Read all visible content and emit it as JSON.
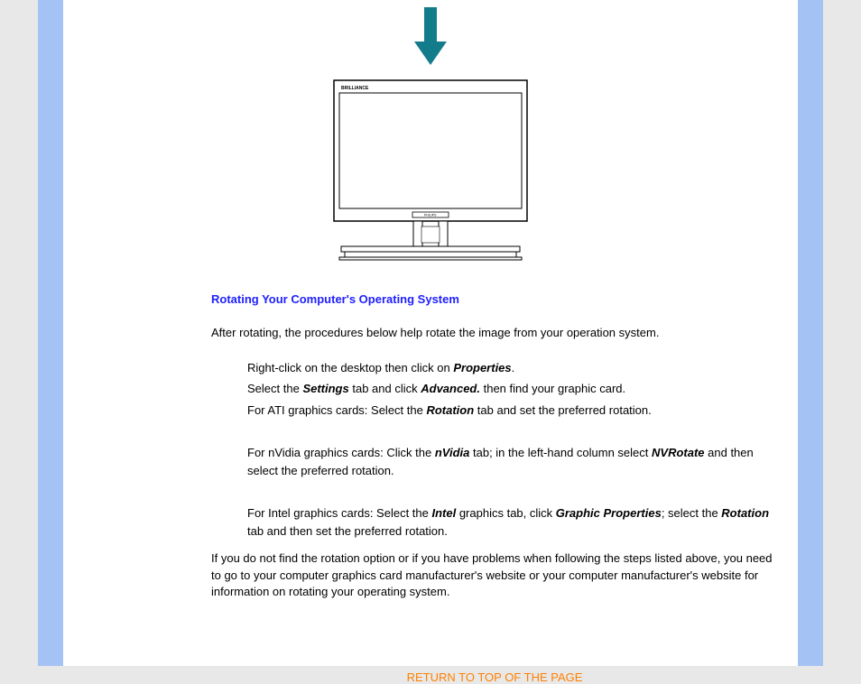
{
  "section_title": "Rotating Your Computer's Operating System",
  "intro": "After rotating, the procedures below help rotate the image from your operation system.",
  "steps": {
    "group1": {
      "line1_pre": "Right-click on the desktop then click on ",
      "line1_b1": "Properties",
      "line1_post": ".",
      "line2_pre": "Select the ",
      "line2_b1": "Settings",
      "line2_mid": " tab and click ",
      "line2_b2": "Advanced.",
      "line2_post": " then find your graphic card.",
      "line3_pre": "For ATI graphics cards: Select the ",
      "line3_b1": "Rotation",
      "line3_post": " tab and set the preferred rotation."
    },
    "group2": {
      "line1_pre": "For nVidia graphics cards: Click the ",
      "line1_b1": "nVidia",
      "line1_mid": " tab; in the left-hand column select ",
      "line1_b2": "NVRotate",
      "line1_post": " and then select the preferred rotation."
    },
    "group3": {
      "line1_pre": "For Intel graphics cards: Select the ",
      "line1_b1": "Intel",
      "line1_mid": " graphics tab, click ",
      "line1_b2": "Graphic Properties",
      "line1_post": "; select the ",
      "line1_b3": "Rotation",
      "line1_end": " tab and then set the preferred rotation."
    }
  },
  "outro": "If you do not find the rotation option or if you have problems when following the steps listed above, you need to go to your computer graphics card manufacturer's website or your computer manufacturer's website for information on rotating your operating system.",
  "return_link": "RETURN TO TOP OF THE PAGE"
}
